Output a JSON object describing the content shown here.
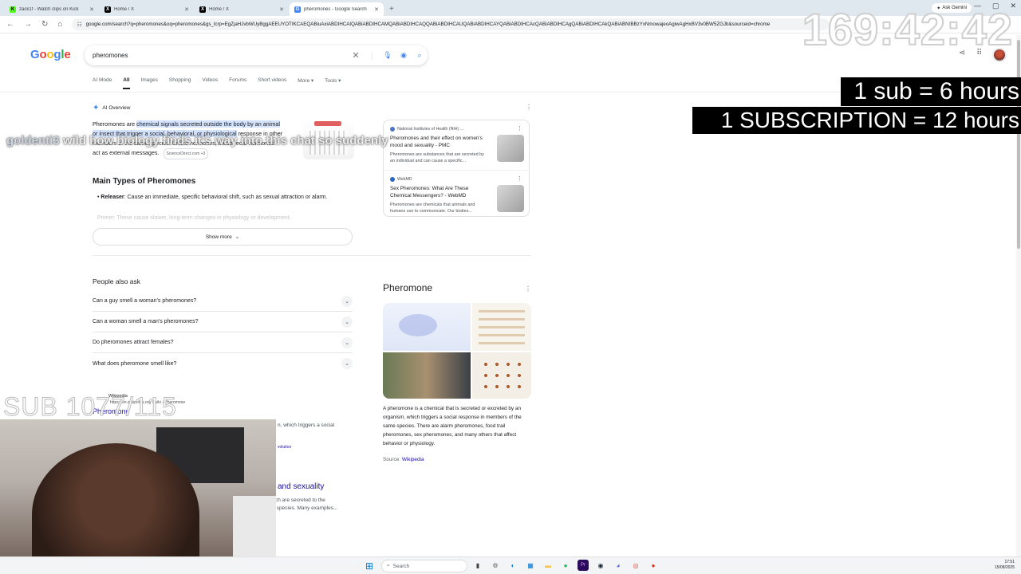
{
  "browser": {
    "tabs": [
      {
        "title": "zack1f - Watch clips on Kick",
        "icon": "kick-icon",
        "color": "#53fc18",
        "glyph": "K",
        "active": false
      },
      {
        "title": "Home / X",
        "icon": "x-icon",
        "color": "#000000",
        "glyph": "X",
        "active": false
      },
      {
        "title": "Home / X",
        "icon": "x-icon",
        "color": "#000000",
        "glyph": "X",
        "active": false
      },
      {
        "title": "pheromones - Google Search",
        "icon": "google-icon",
        "color": "#4285f4",
        "glyph": "G",
        "active": true
      }
    ],
    "ask_gemini": "Ask Gemini",
    "url": "google.com/search?q=pheromones&oq=pheromones&gs_lcrp=EgZjaHJvbWUyBggAEEUYOTIKCAEQABiuAxiABDIHCAIQABiABDIHCAMQABiABDIHCAQQABiABDIHCAUQABiABDIHCAYQABiABDIHCAcQABiABDIHCAgQABiABDIHCAkQABiABNIBBzYxNmowajeoAgiwAgHxBV3v0BW5ZGJb&sourceid=chrome"
  },
  "google": {
    "logo": [
      "G",
      "o",
      "o",
      "g",
      "l",
      "e"
    ],
    "query": "pheromones",
    "filters": [
      "AI Mode",
      "All",
      "Images",
      "Shopping",
      "Videos",
      "Forums",
      "Short videos",
      "More",
      "Tools"
    ],
    "active_filter": "All"
  },
  "ai_overview": {
    "label": "AI Overview",
    "text_lead": "Pheromones are ",
    "text_highlight": "chemical signals secreted outside the body by an animal or insect that trigger a social, behavioral, or physiological",
    "text_rest": " response in other members of the same species. Unlike hormones, these \"ecto-hormones\" act as external messages.",
    "source_chip": "ScienceDirect.com +3",
    "section_title": "Main Types of Pheromones",
    "bullet_term": "Releaser",
    "bullet_text": ": Cause an immediate, specific behavioral shift, such as sexual attraction or alarm.",
    "faded_text": "Primer: These cause slower, long-term changes in physiology or development.",
    "show_more": "Show more",
    "sources": [
      {
        "site": "National Institutes of Health (NIH) ...",
        "title": "Pheromones and their effect on women's mood and sexuality - PMC",
        "desc": "Pheromones are substances that are secreted by an individual and can cause a specific..."
      },
      {
        "site": "WebMD",
        "title": "Sex Pheromones: What Are These Chemical Messengers? - WebMD",
        "desc": "Pheromones are chemicals that animals and humans use to communicate. Our bodies..."
      }
    ]
  },
  "people_also_ask": {
    "title": "People also ask",
    "questions": [
      "Can a guy smell a woman's pheromones?",
      "Can a woman smell a man's pheromones?",
      "Do pheromones attract females?",
      "What does pheromone smell like?"
    ]
  },
  "wiki_result": {
    "source": "Wikipedia",
    "url": "https://en.wikipedia.org › wiki › Pheromone",
    "title": "Pheromone",
    "partial_snippet": "n, which triggers a social",
    "partial_link": "volution",
    "partial_title": "and sexuality",
    "partial_desc": "ch are secreted to the\n species. Many examples..."
  },
  "knowledge_panel": {
    "title": "Pheromone",
    "description": "A pheromone is a chemical that is secreted or excreted by an organism, which triggers a social response in members of the same species. There are alarm pheromones, food trail pheromones, sex pheromones, and many others that affect behavior or physiology.",
    "source_label": "Source: ",
    "source_link": "Wikipedia"
  },
  "overlay": {
    "timer": "169:42:42",
    "sub_rule_1": "1 sub = 6 hours",
    "sub_rule_2": "1 SUBSCRIPTION = 12 hours",
    "chat_user": "goldenti3",
    "chat_message": " wild how biology finds it's way into this chat so suddenly",
    "sub_count": "SUB 1077/115"
  },
  "taskbar": {
    "search": "Search",
    "time": "17:51",
    "date": "15/08/2025",
    "apps": [
      {
        "icon": "files-icon",
        "glyph": "▮",
        "color": "#444444"
      },
      {
        "icon": "settings-icon",
        "glyph": "⚙",
        "color": "#5f6368"
      },
      {
        "icon": "edge-icon",
        "glyph": "◐",
        "color": "#0a7cd6"
      },
      {
        "icon": "store-icon",
        "glyph": "▦",
        "color": "#0078d4"
      },
      {
        "icon": "explorer-icon",
        "glyph": "▬",
        "color": "#f5c242"
      },
      {
        "icon": "spotify-icon",
        "glyph": "●",
        "color": "#1db954"
      },
      {
        "icon": "premiere-icon",
        "glyph": "Pr",
        "color": "#2a0a5a"
      },
      {
        "icon": "steam-icon",
        "glyph": "◉",
        "color": "#1b2838"
      },
      {
        "icon": "discord-icon",
        "glyph": "◕",
        "color": "#5865f2"
      },
      {
        "icon": "chrome-icon",
        "glyph": "◎",
        "color": "#db4437"
      },
      {
        "icon": "app-red-icon",
        "glyph": "●",
        "color": "#d93025"
      }
    ]
  }
}
